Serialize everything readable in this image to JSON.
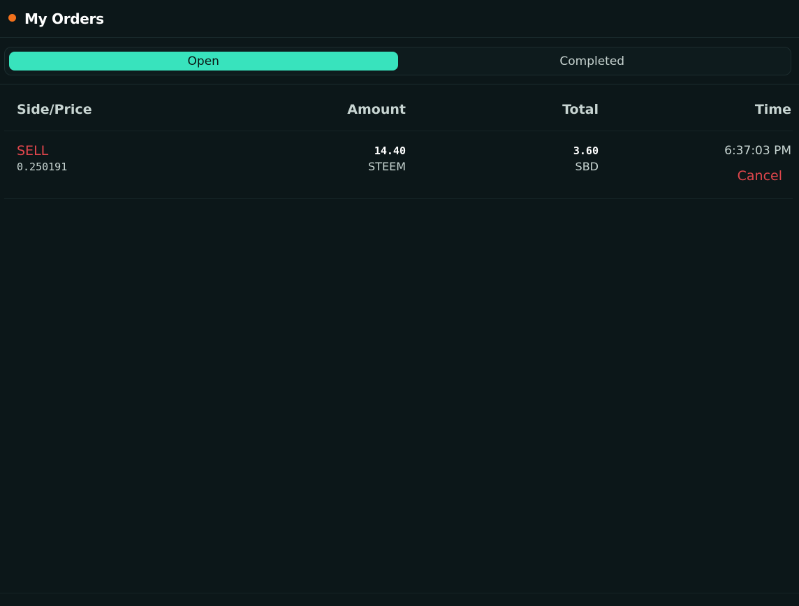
{
  "header": {
    "title": "My Orders",
    "dot_color": "#f2711c"
  },
  "tabs": [
    {
      "label": "Open",
      "active": true
    },
    {
      "label": "Completed",
      "active": false
    }
  ],
  "table": {
    "columns": [
      "Side/Price",
      "Amount",
      "Total",
      "Time"
    ],
    "rows": [
      {
        "side": "SELL",
        "price": "0.250191",
        "amount": "14.40",
        "amount_unit": "STEEM",
        "total": "3.60",
        "total_unit": "SBD",
        "time": "6:37:03 PM",
        "action": "Cancel"
      }
    ]
  },
  "colors": {
    "accent": "#38e3bd",
    "sell": "#e0464c",
    "background": "#0c1719"
  }
}
